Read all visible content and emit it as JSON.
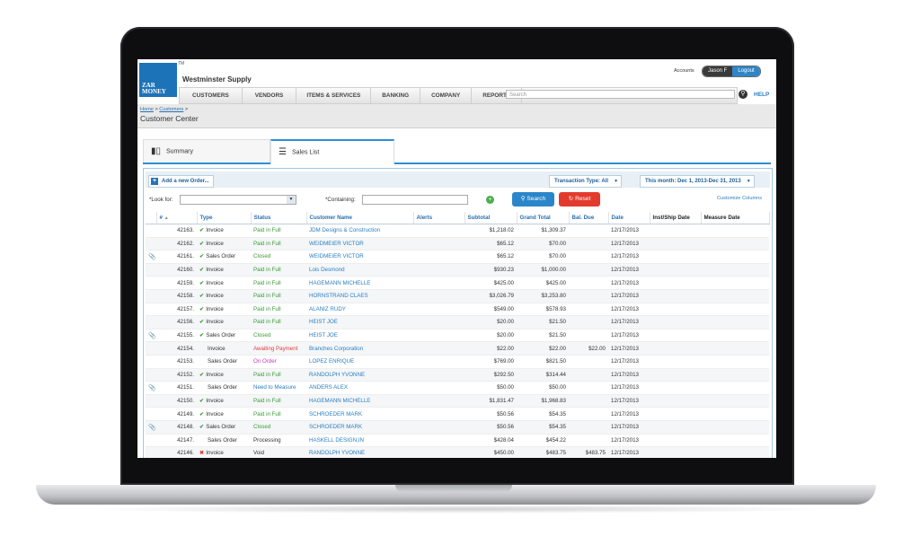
{
  "header": {
    "logo_line1": "ZAR",
    "logo_line2": "MONEY",
    "tm": "TM",
    "company": "Westminster Supply",
    "accounts_label": "Accounts",
    "user": "Jason F",
    "logout": "Logout",
    "help": "HELP"
  },
  "nav": {
    "items": [
      "CUSTOMERS",
      "VENDORS",
      "ITEMS & SERVICES",
      "BANKING",
      "COMPANY",
      "REPORTS"
    ],
    "search_placeholder": "Search"
  },
  "breadcrumb": {
    "home": "Home",
    "customers": "Customers"
  },
  "page_title": "Customer Center",
  "tabs": {
    "summary": "Summary",
    "sales_list": "Sales List"
  },
  "toolbar": {
    "add_order": "Add a new Order...",
    "transaction_type": "Transaction Type: All",
    "date_range": "This month: Dec 1, 2013-Dec 31, 2013"
  },
  "filters": {
    "look_for": "*Look for:",
    "containing": "*Containing:",
    "search": "Search",
    "reset": "Reset",
    "customize": "Customize Columns"
  },
  "columns": [
    "#",
    "Type",
    "Status",
    "Customer Name",
    "Alerts",
    "Subtotal",
    "Grand Total",
    "Bal. Due",
    "Date",
    "Inst/Ship Date",
    "Measure Date"
  ],
  "rows": [
    {
      "num": "42163.",
      "icon": "check",
      "clip": false,
      "type": "Invoice",
      "status": "Paid in Full",
      "sc": "green",
      "customer": "JDM Designs & Construction",
      "subtotal": "$1,218.02",
      "grand": "$1,309.37",
      "bal": "",
      "date": "12/17/2013"
    },
    {
      "num": "42162.",
      "icon": "check",
      "clip": false,
      "type": "Invoice",
      "status": "Paid in Full",
      "sc": "green",
      "customer": "WEIDMEIER VICTOR",
      "subtotal": "$65.12",
      "grand": "$70.00",
      "bal": "",
      "date": "12/17/2013"
    },
    {
      "num": "42161.",
      "icon": "check",
      "clip": true,
      "type": "Sales Order",
      "status": "Closed",
      "sc": "green",
      "customer": "WEIDMEIER VICTOR",
      "subtotal": "$65.12",
      "grand": "$70.00",
      "bal": "",
      "date": "12/17/2013"
    },
    {
      "num": "42160.",
      "icon": "check",
      "clip": false,
      "type": "Invoice",
      "status": "Paid in Full",
      "sc": "green",
      "customer": "Lois Desmond",
      "subtotal": "$930.23",
      "grand": "$1,000.00",
      "bal": "",
      "date": "12/17/2013"
    },
    {
      "num": "42159.",
      "icon": "check",
      "clip": false,
      "type": "Invoice",
      "status": "Paid in Full",
      "sc": "green",
      "customer": "HAGEMANN MICHELLE",
      "subtotal": "$425.00",
      "grand": "$425.00",
      "bal": "",
      "date": "12/17/2013"
    },
    {
      "num": "42158.",
      "icon": "check",
      "clip": false,
      "type": "Invoice",
      "status": "Paid in Full",
      "sc": "green",
      "customer": "HORNSTRAND CLAES",
      "subtotal": "$3,026.79",
      "grand": "$3,253.80",
      "bal": "",
      "date": "12/17/2013"
    },
    {
      "num": "42157.",
      "icon": "check",
      "clip": false,
      "type": "Invoice",
      "status": "Paid in Full",
      "sc": "green",
      "customer": "ALANIZ RUDY",
      "subtotal": "$549.00",
      "grand": "$578.93",
      "bal": "",
      "date": "12/17/2013"
    },
    {
      "num": "42156.",
      "icon": "check",
      "clip": false,
      "type": "Invoice",
      "status": "Paid in Full",
      "sc": "green",
      "customer": "HEIST JOE",
      "subtotal": "$20.00",
      "grand": "$21.50",
      "bal": "",
      "date": "12/17/2013"
    },
    {
      "num": "42155.",
      "icon": "check",
      "clip": true,
      "type": "Sales Order",
      "status": "Closed",
      "sc": "green",
      "customer": "HEIST JOE",
      "subtotal": "$20.00",
      "grand": "$21.50",
      "bal": "",
      "date": "12/17/2013"
    },
    {
      "num": "42154.",
      "icon": "",
      "clip": false,
      "type": "Invoice",
      "status": "Awaiting Payment",
      "sc": "red",
      "customer": "Branches Corporation",
      "subtotal": "$22.00",
      "grand": "$22.00",
      "bal": "$22.00",
      "date": "12/17/2013"
    },
    {
      "num": "42153.",
      "icon": "",
      "clip": false,
      "type": "Sales Order",
      "status": "On Order",
      "sc": "purple",
      "customer": "LOPEZ ENRIQUE",
      "subtotal": "$769.00",
      "grand": "$821.50",
      "bal": "",
      "date": "12/17/2013"
    },
    {
      "num": "42152.",
      "icon": "check",
      "clip": false,
      "type": "Invoice",
      "status": "Paid in Full",
      "sc": "green",
      "customer": "RANDOLPH YVONNE",
      "subtotal": "$292.50",
      "grand": "$314.44",
      "bal": "",
      "date": "12/17/2013"
    },
    {
      "num": "42151.",
      "icon": "",
      "clip": true,
      "type": "Sales Order",
      "status": "Need to Measure",
      "sc": "blue",
      "customer": "ANDERS ALEX",
      "subtotal": "$50.00",
      "grand": "$50.00",
      "bal": "",
      "date": "12/17/2013"
    },
    {
      "num": "42150.",
      "icon": "check",
      "clip": false,
      "type": "Invoice",
      "status": "Paid in Full",
      "sc": "green",
      "customer": "HAGEMANN MICHELLE",
      "subtotal": "$1,831.47",
      "grand": "$1,968.83",
      "bal": "",
      "date": "12/17/2013"
    },
    {
      "num": "42149.",
      "icon": "check",
      "clip": false,
      "type": "Invoice",
      "status": "Paid in Full",
      "sc": "green",
      "customer": "SCHROEDER MARK",
      "subtotal": "$50.56",
      "grand": "$54.35",
      "bal": "",
      "date": "12/17/2013"
    },
    {
      "num": "42148.",
      "icon": "check",
      "clip": true,
      "type": "Sales Order",
      "status": "Closed",
      "sc": "green",
      "customer": "SCHROEDER MARK",
      "subtotal": "$50.56",
      "grand": "$54.35",
      "bal": "",
      "date": "12/17/2013"
    },
    {
      "num": "42147.",
      "icon": "",
      "clip": false,
      "type": "Sales Order",
      "status": "Processing",
      "sc": "dark",
      "customer": "HASKELL DESIGN,IN",
      "subtotal": "$428.04",
      "grand": "$454.22",
      "bal": "",
      "date": "12/17/2013"
    },
    {
      "num": "42146.",
      "icon": "x",
      "clip": false,
      "type": "Invoice",
      "status": "Void",
      "sc": "dark",
      "customer": "RANDOLPH YVONNE",
      "subtotal": "$450.00",
      "grand": "$483.75",
      "bal": "$483.75",
      "date": "12/17/2013"
    }
  ]
}
